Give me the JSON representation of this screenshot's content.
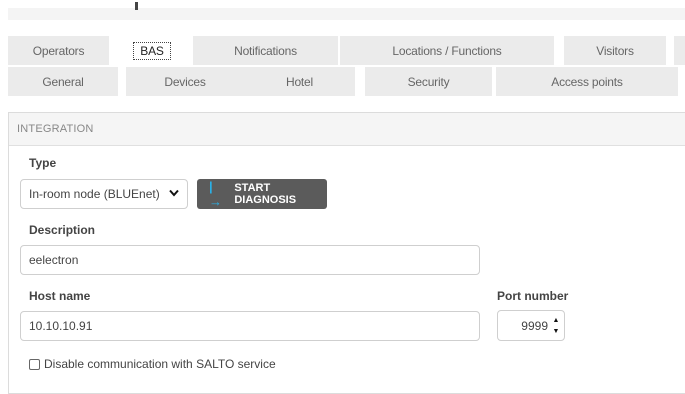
{
  "tabs_row1": [
    {
      "label": "Operators",
      "active": false
    },
    {
      "label": "BAS",
      "active": true
    },
    {
      "label": "Notifications",
      "active": false
    },
    {
      "label": "Locations / Functions",
      "active": false
    },
    {
      "label": "Visitors",
      "active": false
    }
  ],
  "tabs_row2": [
    {
      "label": "General"
    },
    {
      "label": "Devices"
    },
    {
      "label": "Hotel"
    },
    {
      "label": "Security"
    },
    {
      "label": "Access points"
    }
  ],
  "section": {
    "title": "INTEGRATION",
    "type_label": "Type",
    "type_value": "In-room node (BLUEnet)",
    "diagnosis_button": "START DIAGNOSIS",
    "description_label": "Description",
    "description_value": "eelectron",
    "host_label": "Host name",
    "host_value": "10.10.10.91",
    "port_label": "Port number",
    "port_value": "9999",
    "checkbox_label": "Disable communication with SALTO service",
    "checkbox_checked": false
  },
  "colors": {
    "tab_bg": "#ebebeb",
    "button_bg": "#5b5b5b",
    "accent": "#2ab0e6"
  },
  "icons": {
    "select_chevron": "chevron-down-icon",
    "diagnosis": "start-diagnosis-icon"
  }
}
